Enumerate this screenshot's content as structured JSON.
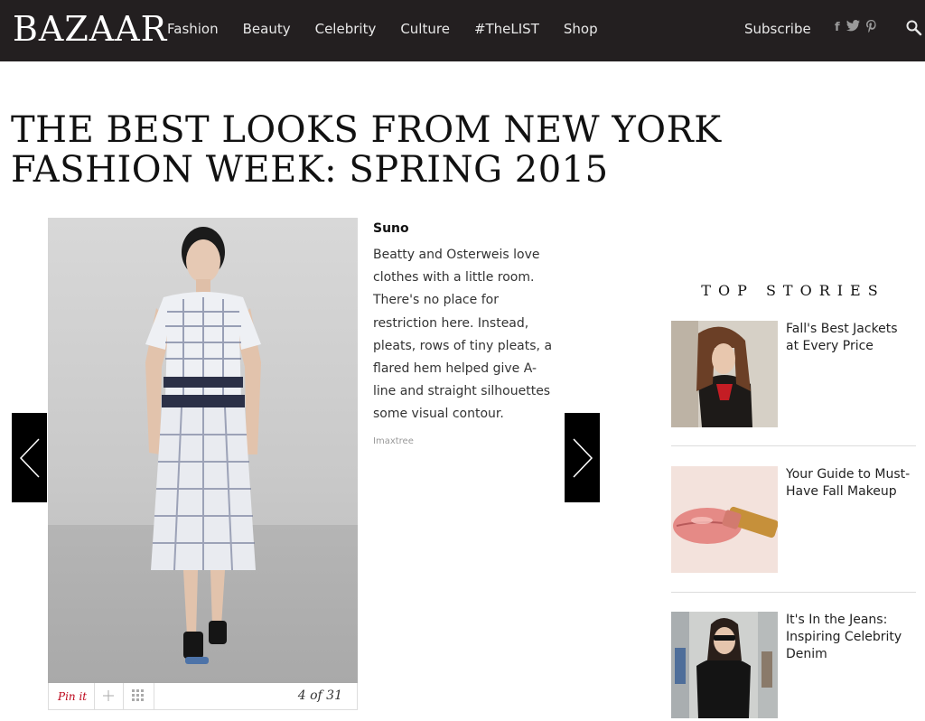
{
  "header": {
    "logo": "BAZAAR",
    "nav": [
      "Fashion",
      "Beauty",
      "Celebrity",
      "Culture",
      "#TheLIST",
      "Shop"
    ],
    "subscribe": "Subscribe",
    "social": {
      "facebook": "f",
      "twitter": "t",
      "pinterest": "p"
    }
  },
  "page": {
    "title": "THE BEST LOOKS FROM NEW YORK FASHION WEEK: SPRING 2015"
  },
  "slide": {
    "designer": "Suno",
    "description": "Beatty and Osterweis love clothes with a little room. There's no place for restriction here. Instead, pleats, rows of tiny pleats, a flared hem helped give A-line and straight silhouettes some visual contour.",
    "credit": "Imaxtree",
    "pin_label": "Pin it",
    "counter": "4 of 31"
  },
  "top_stories": {
    "heading": "TOP STORIES",
    "items": [
      {
        "title": "Fall's Best Jackets at Every Price"
      },
      {
        "title": "Your Guide to Must-Have Fall Makeup"
      },
      {
        "title": "It's In the Jeans: Inspiring Celebrity Denim"
      }
    ]
  },
  "colors": {
    "header_bg": "#231f20",
    "pin_red": "#bd081c",
    "arrow_bg": "#000000"
  }
}
